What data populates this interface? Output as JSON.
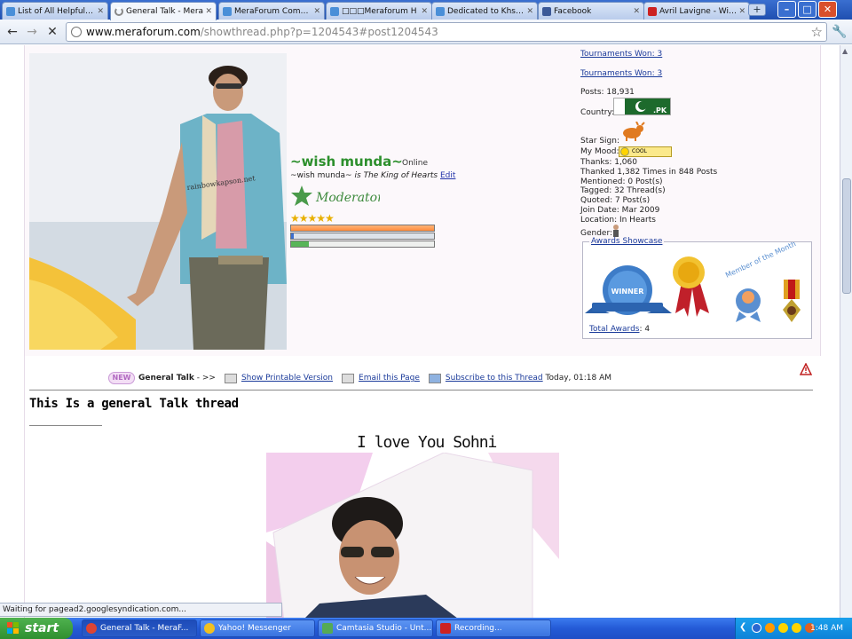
{
  "browser": {
    "tabs": [
      {
        "title": "List of All Helpful Fo",
        "icon_color": "#4a8fd8",
        "active": false
      },
      {
        "title": "General Talk - Mera",
        "icon_color": "#888888",
        "active": true
      },
      {
        "title": "MeraForum Commu",
        "icon_color": "#4a8fd8",
        "active": false
      },
      {
        "title": "□□□Meraforum H",
        "icon_color": "#4a8fd8",
        "active": false
      },
      {
        "title": "Dedicated to Khsuhi",
        "icon_color": "#4a8fd8",
        "active": false
      },
      {
        "title": "Facebook",
        "icon_color": "#3b5998",
        "active": false
      },
      {
        "title": "Avril Lavigne - Wish",
        "icon_color": "#cc2222",
        "active": false
      }
    ],
    "url_host": "www.meraforum.com",
    "url_path": "/showthread.php?p=1204543#post1204543",
    "status_text": "Waiting for pagead2.googlesyndication.com..."
  },
  "profile": {
    "username": "~wish munda~",
    "online_label": "Online",
    "status_prefix": "~wish munda~",
    "status_is": "is",
    "status_text": "The King of Hearts",
    "status_edit": "Edit",
    "rank_text": "Moderator",
    "stars": "★★★★★",
    "tournaments_won_1": "Tournaments Won: 3",
    "tournaments_won_2": "Tournaments Won: 3",
    "posts": "Posts: 18,931",
    "country_label": "Country:",
    "flag_code": ".PK",
    "star_sign_label": "Star Sign:",
    "my_mood_label": "My Mood:",
    "mood_value": "COOL",
    "thanks": "Thanks: 1,060",
    "thanked": "Thanked 1,382 Times in 848 Posts",
    "mentioned": "Mentioned: 0 Post(s)",
    "tagged": "Tagged: 32 Thread(s)",
    "quoted": "Quoted: 7 Post(s)",
    "join_date": "Join Date: Mar 2009",
    "location": "Location: In Hearts",
    "gender_label": "Gender:",
    "awards_legend": "Awards Showcase",
    "total_awards_label": "Total Awards",
    "total_awards_value": ": 4",
    "avatar_watermark": "rainbowkapson.net"
  },
  "awards": {
    "winner_text": "WINNER",
    "member_month_text": "Member of the Month"
  },
  "post": {
    "new_badge": "NEW",
    "forum_name": "General Talk",
    "arrows": "- >>",
    "printable": "Show Printable Version",
    "email": "Email this Page",
    "subscribe": "Subscribe to this Thread",
    "timestamp": "Today, 01:18 AM",
    "thread_title": "This Is a general Talk thread",
    "message": "I love You Sohni"
  },
  "taskbar": {
    "start_label": "start",
    "items": [
      {
        "label": "General Talk - MeraF...",
        "icon_color": "#dd4433",
        "active": true
      },
      {
        "label": "Yahoo! Messenger",
        "icon_color": "#f0c020",
        "active": false
      },
      {
        "label": "Camtasia Studio - Unt...",
        "icon_color": "#55aa55",
        "active": false
      },
      {
        "label": "Recording...",
        "icon_color": "#cc2222",
        "active": false
      }
    ],
    "clock": "1:48 AM"
  }
}
